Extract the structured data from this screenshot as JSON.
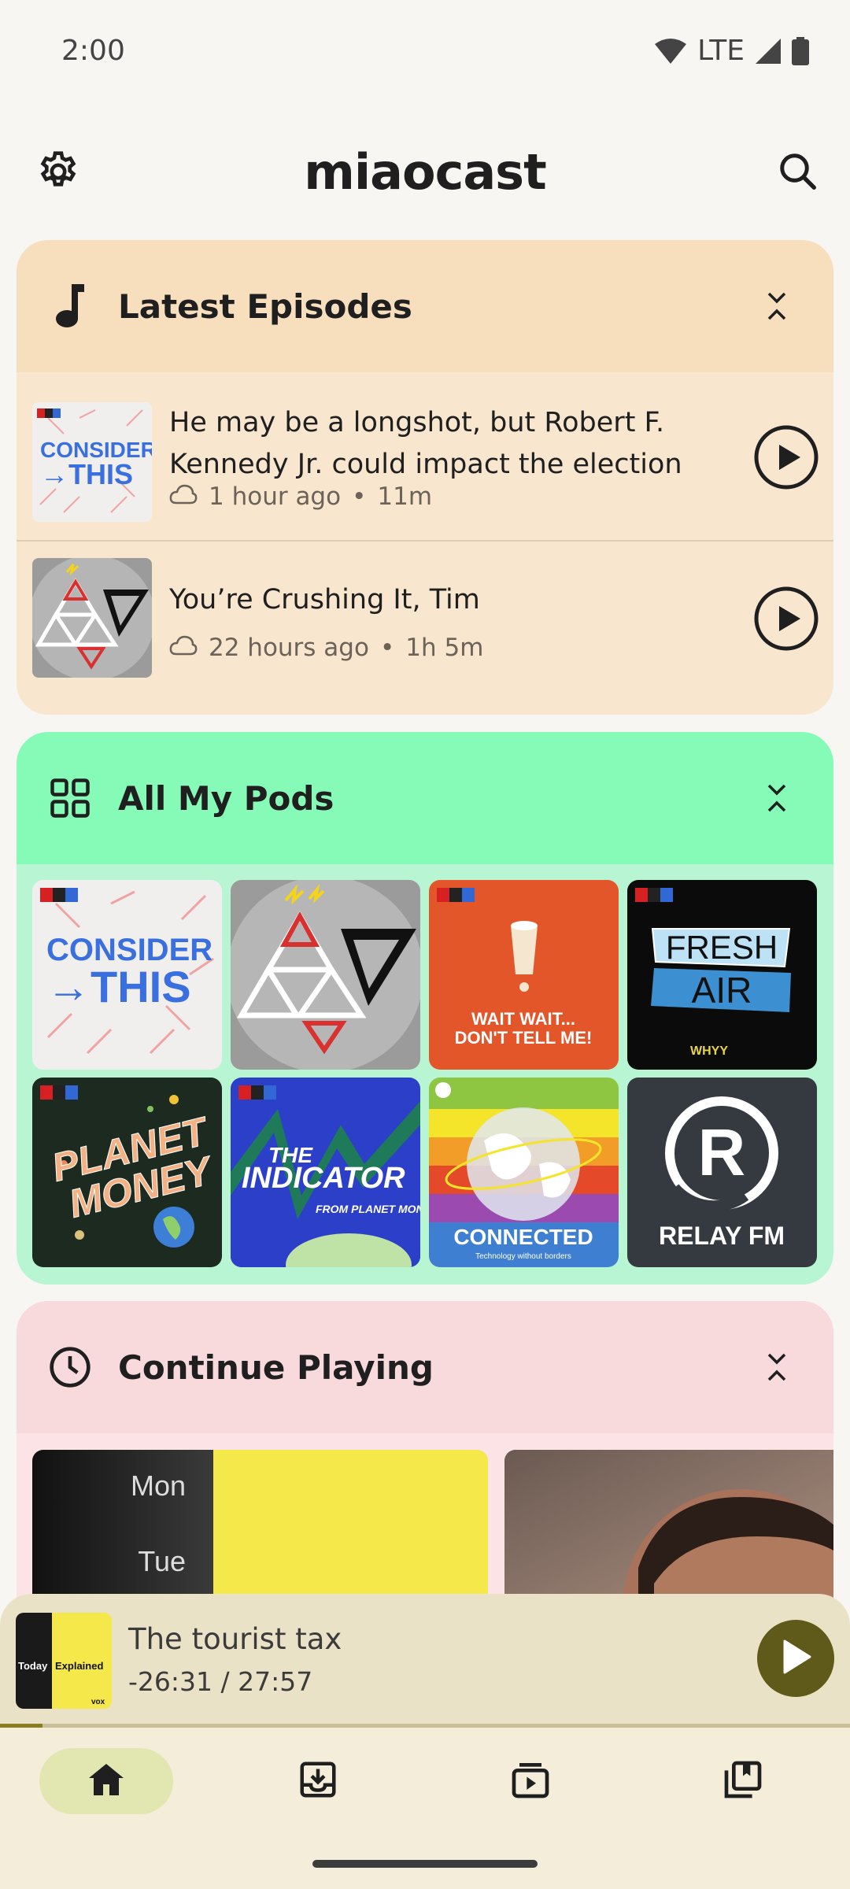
{
  "status_bar": {
    "time": "2:00",
    "network": "LTE"
  },
  "app_bar": {
    "title": "miaocast",
    "settings_icon": "gear-icon",
    "search_icon": "search-icon"
  },
  "latest": {
    "title": "Latest Episodes",
    "icon": "music-note-icon",
    "episodes": [
      {
        "title": "He may be a longshot, but Robert F. Kennedy Jr. could impact the election",
        "age": "1 hour ago",
        "duration": "11m",
        "art": {
          "npr": "npr",
          "line1": "CONSIDER",
          "line2": "→THIS"
        }
      },
      {
        "title": "You’re Crushing It, Tim",
        "age": "22 hours ago",
        "duration": "1h 5m"
      }
    ]
  },
  "pods": {
    "title": "All My Pods",
    "icon": "grid-icon",
    "items": [
      {
        "name": "consider-this",
        "npr": "npr",
        "line1": "CONSIDER",
        "line2": "→THIS"
      },
      {
        "name": "triangle-podcast"
      },
      {
        "name": "wait-wait",
        "npr": "npr",
        "line1": "WAIT WAIT...",
        "line2": "DON'T TELL ME!"
      },
      {
        "name": "fresh-air",
        "npr": "npr",
        "line1": "FRESH",
        "line2": "AIR",
        "foot": "WHYY"
      },
      {
        "name": "planet-money",
        "npr": "npr",
        "line1": "PLANET",
        "line2": "MONEY"
      },
      {
        "name": "the-indicator",
        "npr": "npr",
        "line1": "THE",
        "line2": "INDICATOR",
        "line3": "FROM PLANET MONEY"
      },
      {
        "name": "connected",
        "line1": "CONNECTED",
        "line2": "Technology without borders"
      },
      {
        "name": "relay-fm",
        "line1": "RELAY FM"
      }
    ]
  },
  "continue": {
    "title": "Continue Playing",
    "icon": "clock-icon",
    "art1": {
      "day1": "Mon",
      "day2": "Tue"
    }
  },
  "mini_player": {
    "title": "The tourist tax",
    "time": "-26:31 / 27:57",
    "progress": 0.05,
    "art": {
      "today": "Today",
      "explained": "Explained",
      "vox": "vox"
    }
  },
  "bottom_nav": {
    "items": [
      {
        "name": "home",
        "icon": "home-icon",
        "active": true
      },
      {
        "name": "downloads",
        "icon": "download-icon",
        "active": false
      },
      {
        "name": "queue",
        "icon": "playlist-icon",
        "active": false
      },
      {
        "name": "library",
        "icon": "library-icon",
        "active": false
      }
    ]
  },
  "colors": {
    "latest_bg": "#f8e6cf",
    "pods_bg": "#b7f5d3",
    "continue_bg": "#fce4e6",
    "player_bg": "#e9e2c6",
    "accent": "#5f5a1a"
  }
}
